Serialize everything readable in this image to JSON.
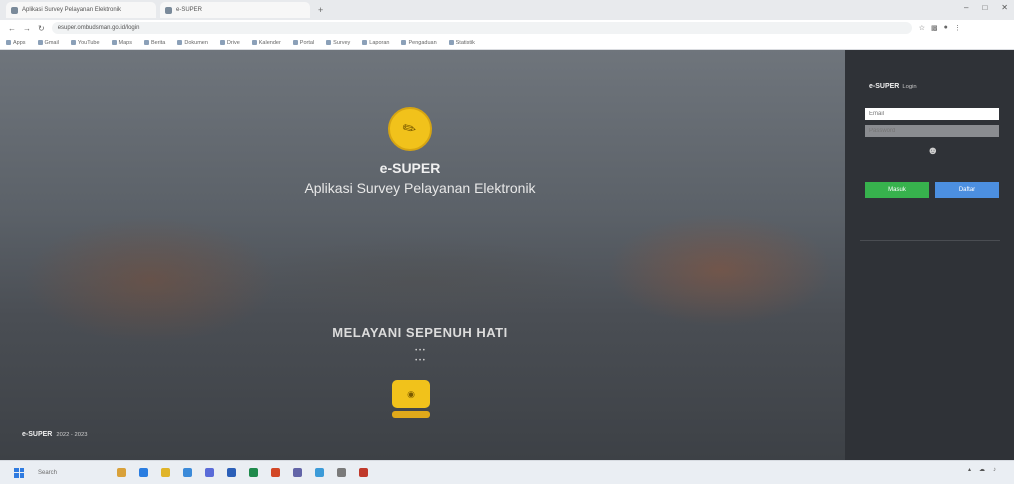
{
  "browser": {
    "tabs": [
      {
        "label": "Aplikasi Survey Pelayanan Elektronik",
        "active": true
      },
      {
        "label": "e-SUPER",
        "active": false
      }
    ],
    "new_tab_symbol": "+",
    "window_controls": [
      "–",
      "□",
      "✕"
    ],
    "url": "esuper.ombudsman.go.id/login",
    "bookmarks": [
      "Apps",
      "Gmail",
      "YouTube",
      "Maps",
      "Berita",
      "Dokumen",
      "Drive",
      "Kalender",
      "Portal",
      "Survey",
      "Laporan",
      "Pengaduan",
      "Statistik"
    ]
  },
  "hero": {
    "logo_icon": "compass-icon",
    "brand": "e-SUPER",
    "tagline": "Aplikasi Survey Pelayanan Elektronik",
    "slogan": "MELAYANI SEPENUH HATI",
    "sub_line_1": "• • •",
    "sub_line_2": "• • •",
    "footer_brand": "e-SUPER",
    "footer_brand_suffix": "2022 - 2023",
    "footer_line": ""
  },
  "login": {
    "title": "e-SUPER",
    "title_suffix": "Login",
    "subtitle": "",
    "username_placeholder": "Email",
    "password_placeholder": "Password",
    "captcha_label": "",
    "captcha_icon": "user-icon",
    "hint": "",
    "login_button": "Masuk",
    "register_button": "Daftar",
    "forgot_link": "",
    "footer": ""
  },
  "taskbar": {
    "search_label": "Search",
    "apps": [
      "file-explorer-icon",
      "edge-icon",
      "chrome-icon",
      "mail-icon",
      "store-icon",
      "word-icon",
      "excel-icon",
      "powerpoint-icon",
      "teams-icon",
      "photos-icon",
      "settings-icon",
      "calendar-icon"
    ],
    "app_colors": [
      "#d9a13a",
      "#2a7de1",
      "#e0b429",
      "#3b8ad9",
      "#5a6bd8",
      "#2b5fb8",
      "#1f8a4c",
      "#d24726",
      "#6264a7",
      "#3c9bd8",
      "#7a7a7a",
      "#c0392b"
    ],
    "tray_icons": [
      "▴",
      "☁",
      "♪"
    ],
    "time": "",
    "date": ""
  }
}
